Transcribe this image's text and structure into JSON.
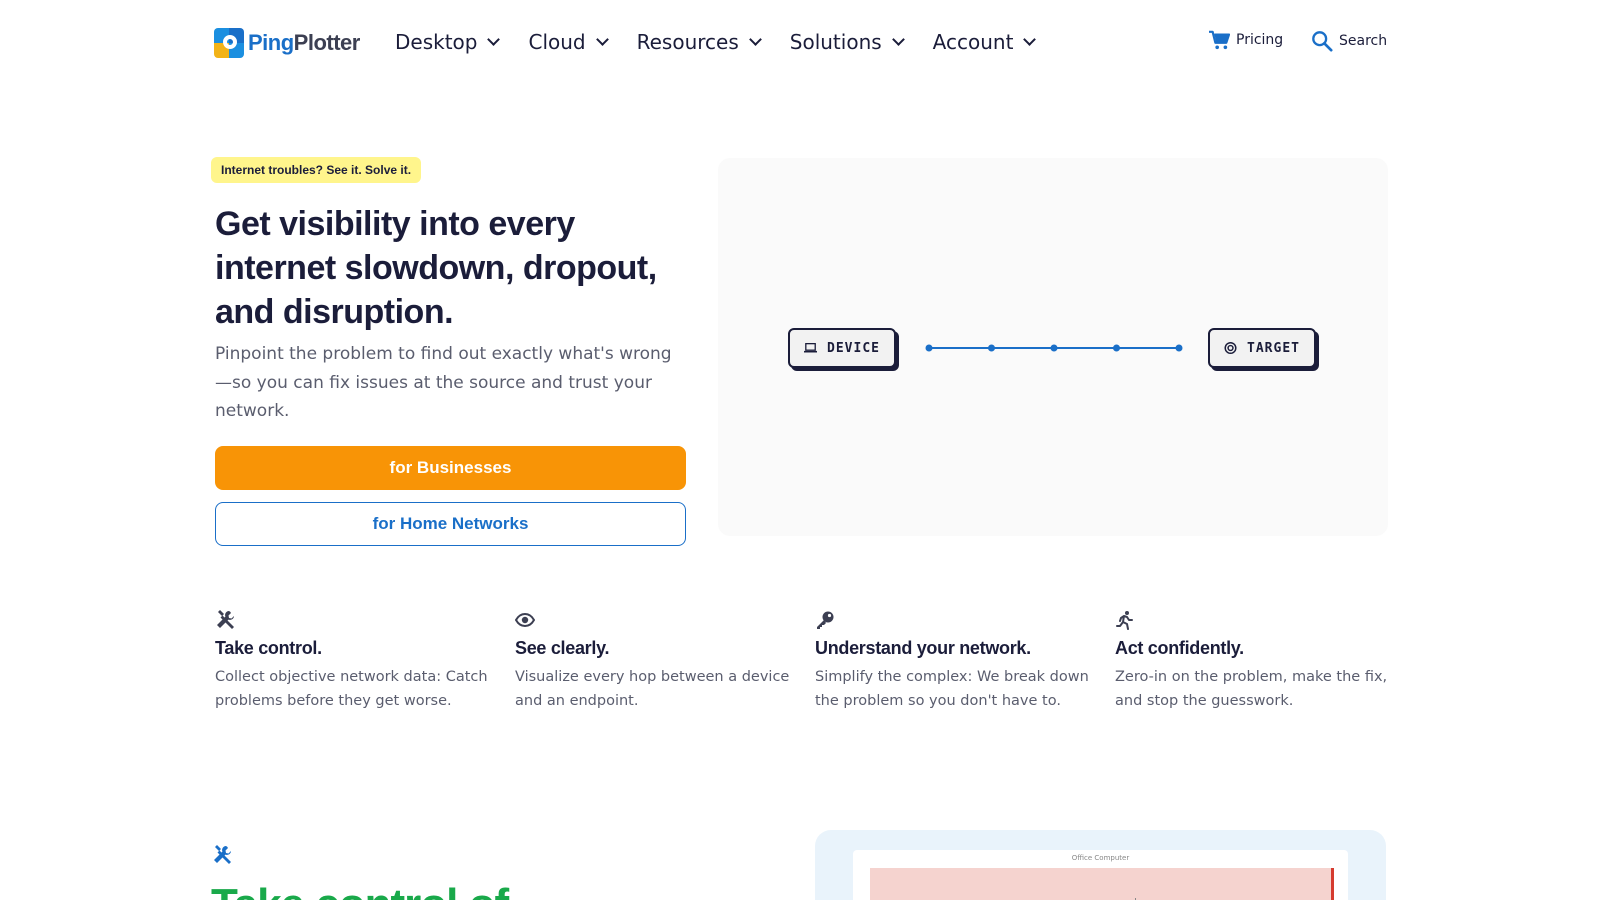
{
  "brand": {
    "ping": "Ping",
    "plotter": "Plotter",
    "colors": {
      "primary": "#1a6fc8",
      "accent": "#f89406",
      "tag": "#fff58c",
      "green": "#19a94a"
    }
  },
  "nav": {
    "items": [
      {
        "label": "Desktop"
      },
      {
        "label": "Cloud"
      },
      {
        "label": "Resources"
      },
      {
        "label": "Solutions"
      },
      {
        "label": "Account"
      }
    ],
    "pricing_label": "Pricing",
    "search_label": "Search"
  },
  "hero": {
    "tag": "Internet troubles? See it. Solve it.",
    "title": "Get visibility into every internet slowdown, dropout, and disruption.",
    "subtitle": "Pinpoint the problem to find out exactly what's wrong—so you can fix issues at the source and trust your network.",
    "btn_business": "for Businesses",
    "btn_home": "for Home Networks"
  },
  "diagram": {
    "device_label": "DEVICE",
    "target_label": "TARGET",
    "hops": 5
  },
  "features": [
    {
      "icon": "tools-icon",
      "title": "Take control.",
      "desc": "Collect objective network data: Catch problems before they get worse."
    },
    {
      "icon": "eye-icon",
      "title": "See clearly.",
      "desc": "Visualize every hop between a device and an endpoint."
    },
    {
      "icon": "key-icon",
      "title": "Understand your network.",
      "desc": "Simplify the complex: We break down the problem so you don't have to."
    },
    {
      "icon": "running-icon",
      "title": "Act confidently.",
      "desc": "Zero-in on the problem, make the fix, and stop the guesswork."
    }
  ],
  "bottom": {
    "heading": "Take control of",
    "preview_label": "Office Computer"
  }
}
